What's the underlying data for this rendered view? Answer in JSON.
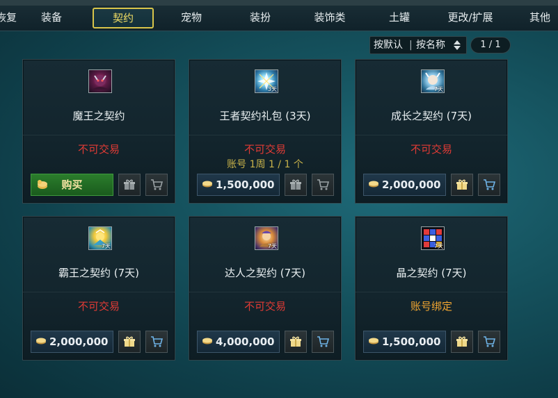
{
  "tabs": [
    {
      "label": "恢复"
    },
    {
      "label": "装备"
    },
    {
      "label": "契约"
    },
    {
      "label": "宠物"
    },
    {
      "label": "装扮"
    },
    {
      "label": "装饰类"
    },
    {
      "label": "土罐"
    },
    {
      "label": "更改/扩展"
    },
    {
      "label": "其他"
    }
  ],
  "active_tab": "契约",
  "sort": {
    "option_a": "按默认",
    "separator": "|",
    "option_b": "按名称"
  },
  "pager": {
    "text": "1 / 1"
  },
  "items": [
    {
      "name": "魔王之契约",
      "status": "不可交易",
      "action": "购买",
      "icon": "demon-king-icon"
    },
    {
      "name": "王者契约礼包 (3天)",
      "status": "不可交易",
      "limit": "账号 1周 1 / 1 个",
      "price": "1,500,000",
      "icon": "king-bundle-icon",
      "icon_days": "3天"
    },
    {
      "name": "成长之契约 (7天)",
      "status": "不可交易",
      "price": "2,000,000",
      "icon": "growth-icon",
      "icon_days": "7天"
    },
    {
      "name": "霸王之契约 (7天)",
      "status": "不可交易",
      "price": "2,000,000",
      "icon": "overlord-icon",
      "icon_days": "7天"
    },
    {
      "name": "达人之契约 (7天)",
      "status": "不可交易",
      "price": "4,000,000",
      "icon": "expert-icon",
      "icon_days": "7天"
    },
    {
      "name": "晶之契约 (7天)",
      "status": "账号绑定",
      "price": "1,500,000",
      "icon": "crystal-icon",
      "icon_days": "7天"
    }
  ],
  "colors": {
    "untradable": "#e23b35",
    "account_bound": "#f0a531",
    "active_tab_border": "#d8c54a",
    "buy_button": "#2b7d2c"
  }
}
